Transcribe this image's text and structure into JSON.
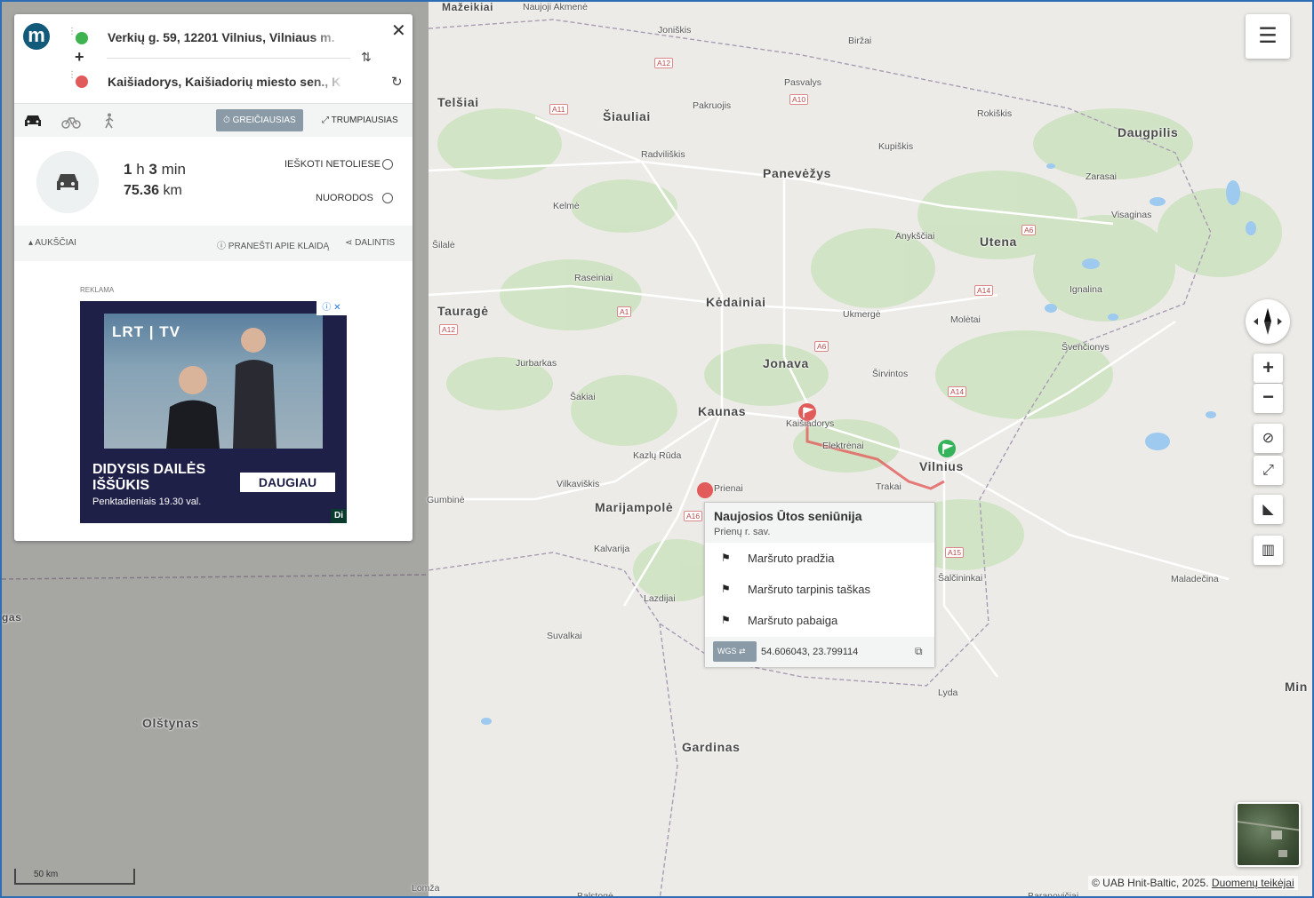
{
  "route": {
    "from": "Verkių g. 59, 12201 Vilnius, Vilniaus m.",
    "to": "Kaišiadorys, Kaišiadorių miesto sen., K",
    "options": {
      "fastest": "GREIČIAUSIAS",
      "shortest": "TRUMPIAUSIAS"
    },
    "summary": {
      "hours": "1",
      "h_unit": "h",
      "minutes": "3",
      "min_unit": "min",
      "distance": "75.36",
      "distance_unit": "km"
    },
    "actions": {
      "search_nearby": "IEŠKOTI NETOLIESE",
      "directions": "NUORODOS"
    },
    "tools": {
      "elevation": "AUKŠČIAI",
      "report": "PRANEŠTI APIE KLAIDĄ",
      "share": "DALINTIS"
    }
  },
  "ad": {
    "label": "REKLAMA",
    "brand": "LRT | TV",
    "title_line1": "DIDYSIS DAILĖS",
    "title_line2": "IŠŠŪKIS",
    "subtitle": "Penktadieniais 19.30 val.",
    "cta": "DAUGIAU",
    "badge": "Di"
  },
  "popup": {
    "title": "Naujosios Ūtos seniūnija",
    "subtitle": "Prienų r. sav.",
    "items": [
      "Maršruto pradžia",
      "Maršruto tarpinis taškas",
      "Maršruto pabaiga"
    ],
    "coord_system": "WGS",
    "coords": "54.606043, 23.799114"
  },
  "map": {
    "scale_label": "50 km",
    "attribution": "© UAB Hnit-Baltic, 2025.",
    "attribution_link": "Duomenų teikėjai",
    "cities": [
      {
        "name": "Mažeikiai"
      },
      {
        "name": "Telšiai"
      },
      {
        "name": "Šiauliai"
      },
      {
        "name": "Panevėžys"
      },
      {
        "name": "Daugpilis"
      },
      {
        "name": "Utena"
      },
      {
        "name": "Tauragė"
      },
      {
        "name": "Kėdainiai"
      },
      {
        "name": "Jonava"
      },
      {
        "name": "Kaunas"
      },
      {
        "name": "Vilnius"
      },
      {
        "name": "Marijampolė"
      },
      {
        "name": "Olštynas"
      },
      {
        "name": "Gardinas"
      },
      {
        "name": "Min"
      },
      {
        "name": "gas"
      }
    ],
    "towns": [
      "Naujoji Akmenė",
      "Joniškis",
      "Biržai",
      "Pasvalys",
      "Pakruojis",
      "Rokiškis",
      "Radviliškis",
      "Kupiškis",
      "Zarasai",
      "Kelmė",
      "Visaginas",
      "Anykščiai",
      "Šilalė",
      "Raseiniai",
      "Ignalina",
      "Ukmergė",
      "Molėtai",
      "Jurbarkas",
      "Švenčionys",
      "Širvintos",
      "Šakiai",
      "Kaišiadorys",
      "Elektrėnai",
      "Kazlų Rūda",
      "Vilkaviškis",
      "Prienai",
      "Trakai",
      "Gumbinė",
      "Kalvarija",
      "Šalčininkai",
      "Maladečina",
      "Lazdijai",
      "Suvalkai",
      "Lyda",
      "Lomža",
      "Balstogė",
      "Baranovičiai"
    ],
    "roads": [
      "A12",
      "A11",
      "A10",
      "A6",
      "A14",
      "A1",
      "A12",
      "A6",
      "A14",
      "A16",
      "A15"
    ]
  }
}
